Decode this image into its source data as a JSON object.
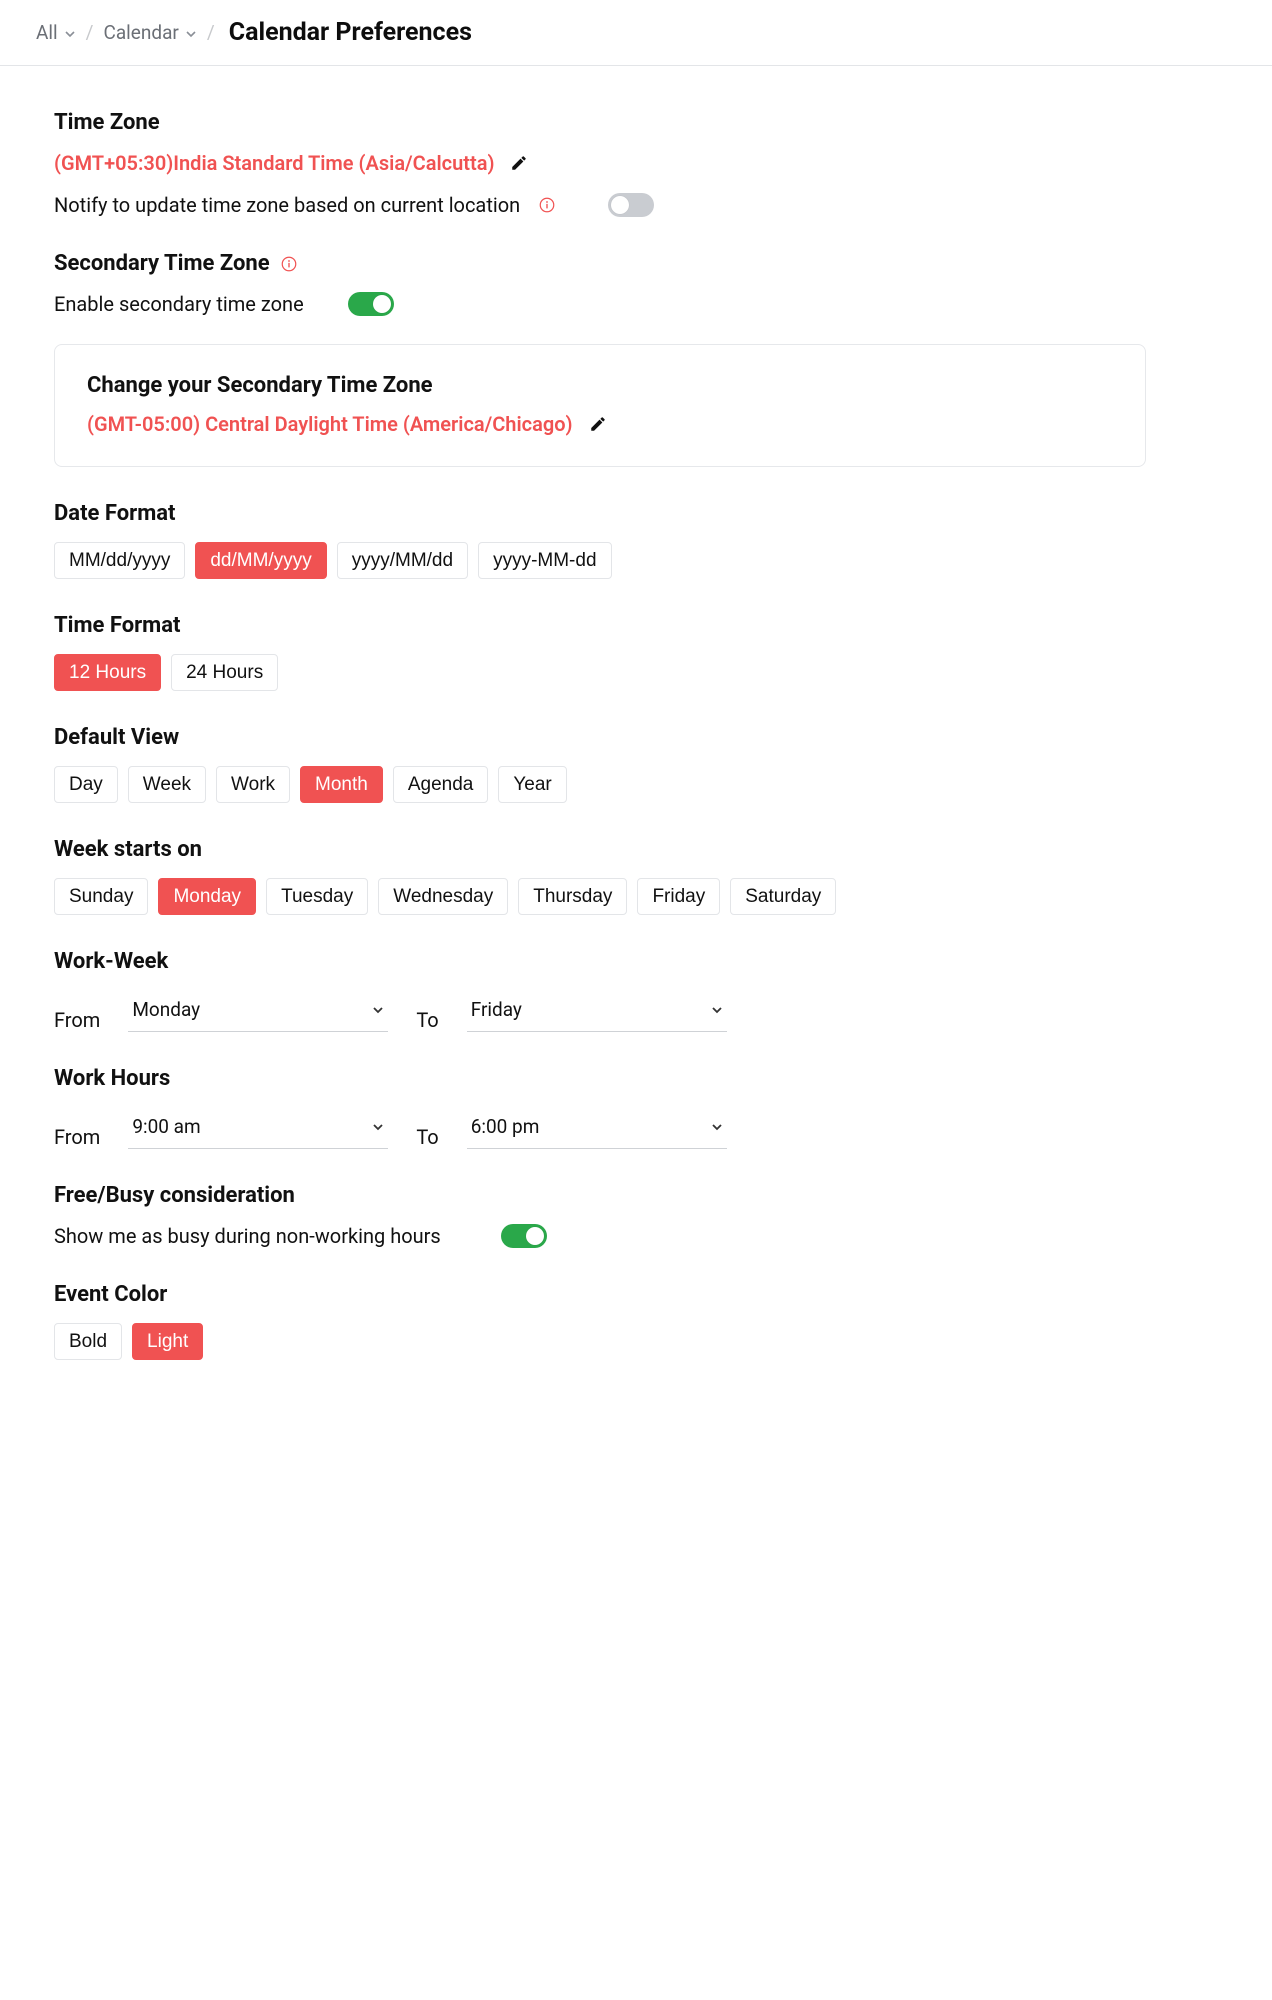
{
  "breadcrumb": {
    "all": "All",
    "calendar": "Calendar",
    "page_title": "Calendar Preferences"
  },
  "colors": {
    "accent": "#f05252",
    "green": "#2aa84a"
  },
  "time_zone": {
    "heading": "Time Zone",
    "value": "(GMT+05:30)India Standard Time (Asia/Calcutta)",
    "notify_label": "Notify to update time zone based on current location",
    "notify_enabled": false
  },
  "secondary_tz": {
    "heading": "Secondary Time Zone",
    "enable_label": "Enable secondary time zone",
    "enabled": true,
    "card_heading": "Change your Secondary Time Zone",
    "value": "(GMT-05:00) Central Daylight Time (America/Chicago)"
  },
  "date_format": {
    "heading": "Date Format",
    "options": [
      "MM/dd/yyyy",
      "dd/MM/yyyy",
      "yyyy/MM/dd",
      "yyyy-MM-dd"
    ],
    "selected": "dd/MM/yyyy"
  },
  "time_format": {
    "heading": "Time Format",
    "options": [
      "12 Hours",
      "24 Hours"
    ],
    "selected": "12 Hours"
  },
  "default_view": {
    "heading": "Default View",
    "options": [
      "Day",
      "Week",
      "Work",
      "Month",
      "Agenda",
      "Year"
    ],
    "selected": "Month"
  },
  "week_starts_on": {
    "heading": "Week starts on",
    "options": [
      "Sunday",
      "Monday",
      "Tuesday",
      "Wednesday",
      "Thursday",
      "Friday",
      "Saturday"
    ],
    "selected": "Monday"
  },
  "work_week": {
    "heading": "Work-Week",
    "from_label": "From",
    "to_label": "To",
    "from": "Monday",
    "to": "Friday"
  },
  "work_hours": {
    "heading": "Work Hours",
    "from_label": "From",
    "to_label": "To",
    "from": "9:00 am",
    "to": "6:00 pm"
  },
  "free_busy": {
    "heading": "Free/Busy consideration",
    "label": "Show me as busy during non-working hours",
    "enabled": true
  },
  "event_color": {
    "heading": "Event Color",
    "options": [
      "Bold",
      "Light"
    ],
    "selected": "Light"
  }
}
